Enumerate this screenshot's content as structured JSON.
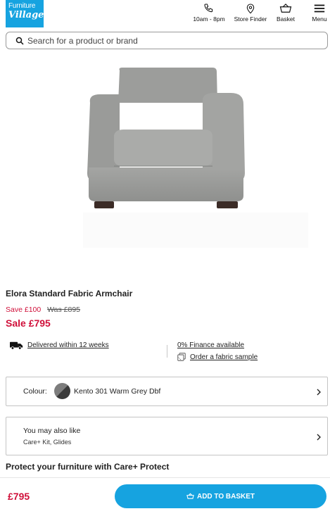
{
  "header": {
    "logo_line1": "Furniture",
    "logo_line2": "Village",
    "phone_label": "10am - 8pm",
    "store_label": "Store Finder",
    "basket_label": "Basket",
    "menu_label": "Menu"
  },
  "search": {
    "placeholder": "Search for a product or brand"
  },
  "product": {
    "title": "Elora Standard Fabric Armchair",
    "save_text": "Save £100",
    "was_text": "Was £895",
    "sale_text": "Sale £795"
  },
  "info": {
    "delivery_link": "Delivered within 12 weeks",
    "finance_link": "0% Finance available",
    "sample_link": "Order a fabric sample"
  },
  "colour": {
    "label": "Colour:",
    "value": "Kento 301 Warm Grey Dbf"
  },
  "also_like": {
    "title": "You may also like",
    "subtitle": "Care+ Kit, Glides"
  },
  "protect_heading": "Protect your furniture with Care+ Protect",
  "footer": {
    "price": "£795",
    "add_button_label": "ADD TO BASKET"
  },
  "colors": {
    "brand_blue": "#16a3e0",
    "sale_red": "#d0103a"
  },
  "icons": [
    "phone-icon",
    "location-pin-icon",
    "basket-icon",
    "hamburger-menu-icon",
    "search-icon",
    "delivery-truck-icon",
    "fabric-sample-icon",
    "chevron-right-icon"
  ]
}
